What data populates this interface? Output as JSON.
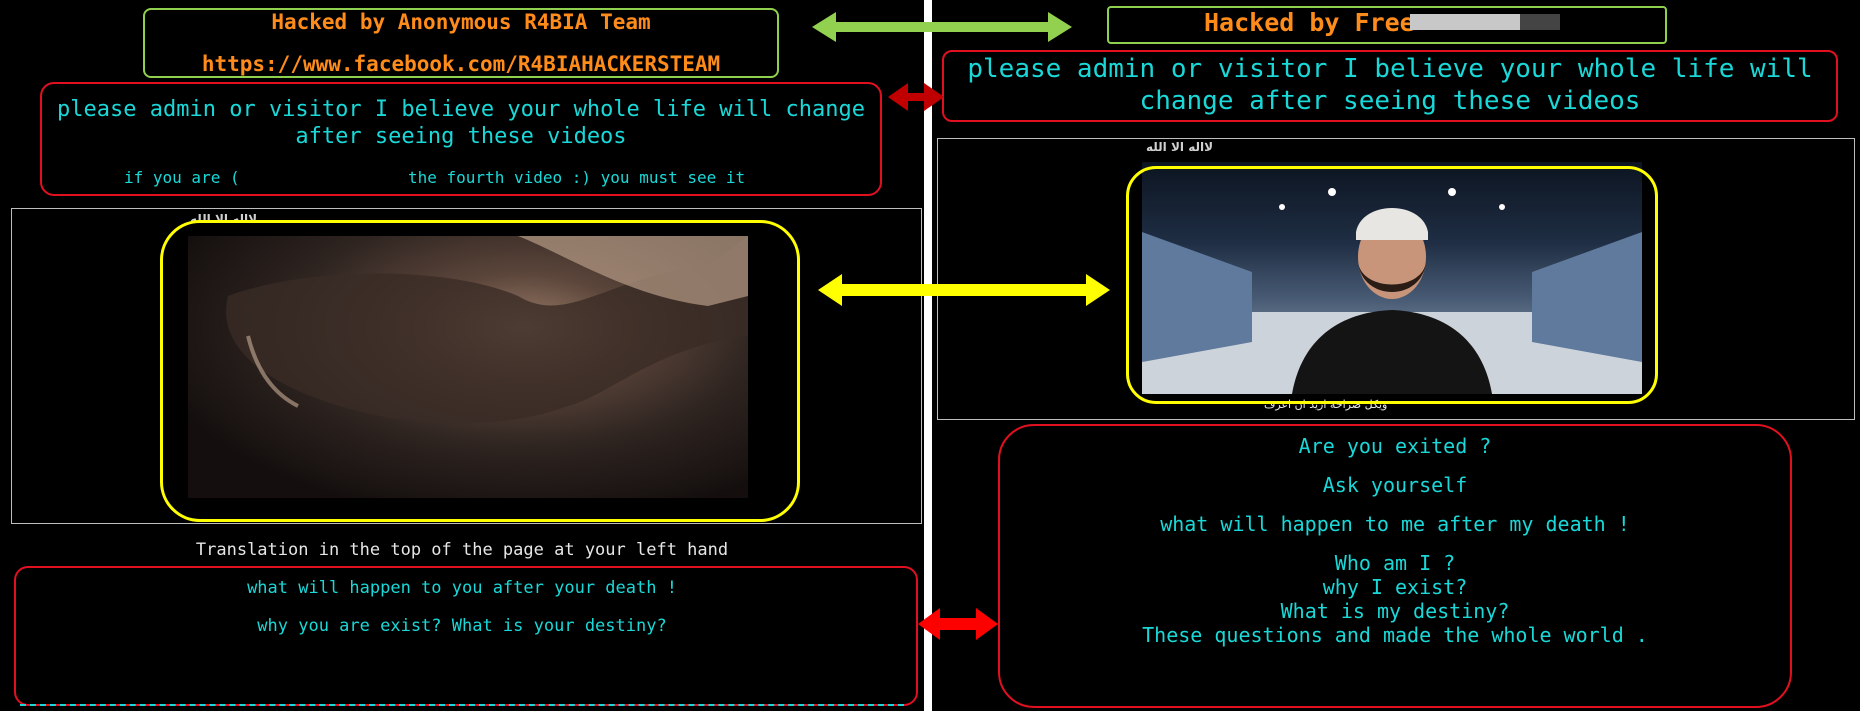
{
  "left": {
    "title": "Hacked by Anonymous R4BIA Team",
    "link": "https://www.facebook.com/R4BIAHACKERSTEAM",
    "message": "please admin or visitor I believe your whole life will change after seeing these videos",
    "subline_a": "if you are (",
    "subline_b": "the fourth video :) you must see it",
    "video_logo": "لااله الا الله",
    "translation_note": "Translation in the top of the page at your left hand",
    "q1": "what will happen to you after your death !",
    "q2": "why you are exist? What is your destiny?"
  },
  "right": {
    "title_visible": "Hacked by Free",
    "message": "please admin or visitor I believe your whole life will change after seeing these videos",
    "video_logo": "لااله الا الله",
    "video_caption": "ويكل صراحة اريد ان اعرف",
    "lines": [
      "Are you exited ?",
      "Ask yourself",
      "what will happen to me after my death !",
      "Who am I ?",
      "why I exist?",
      "What is my destiny?",
      "These questions and made the whole world ."
    ]
  },
  "colors": {
    "green_arrow": "#92d050",
    "yellow_arrow": "#ffff00",
    "red_arrow": "#ff0000",
    "text_cyan": "#1ad8d8",
    "title_orange": "#ff8c1a"
  }
}
